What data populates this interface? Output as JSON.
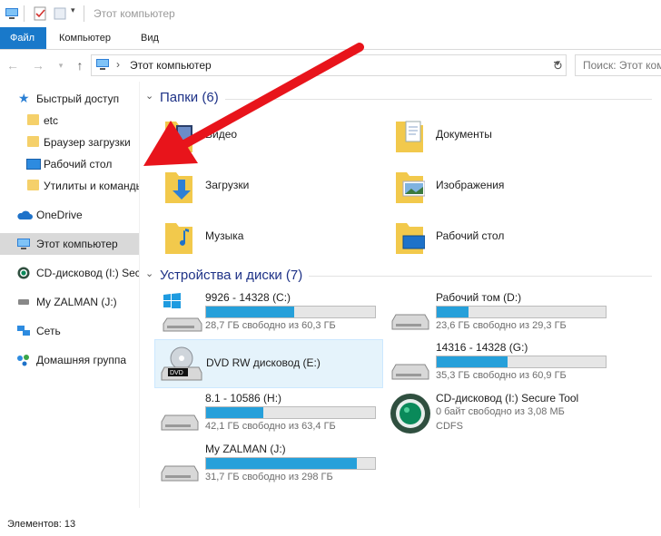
{
  "window": {
    "title": "Этот компьютер"
  },
  "ribbon": {
    "tabs": [
      {
        "label": "Файл",
        "active": true
      },
      {
        "label": "Компьютер",
        "active": false
      },
      {
        "label": "Вид",
        "active": false
      }
    ]
  },
  "address": {
    "path": "Этот компьютер",
    "separator": "›",
    "search_placeholder": "Поиск: Этот ком"
  },
  "nav": {
    "items": [
      {
        "label": "Быстрый доступ",
        "icon": "star-icon"
      },
      {
        "label": "etc",
        "icon": "folder-icon"
      },
      {
        "label": "Браузер загрузки",
        "icon": "folder-icon"
      },
      {
        "label": "Рабочий стол",
        "icon": "desktop-icon"
      },
      {
        "label": "Утилиты и команды",
        "icon": "folder-icon"
      },
      {
        "label": "OneDrive",
        "icon": "cloud-icon"
      },
      {
        "label": "Этот компьютер",
        "icon": "computer-icon",
        "selected": true
      },
      {
        "label": "CD-дисковод (I:) Secure Tool",
        "icon": "cd-icon"
      },
      {
        "label": "My ZALMAN (J:)",
        "icon": "usb-drive-icon"
      },
      {
        "label": "Сеть",
        "icon": "network-icon"
      },
      {
        "label": "Домашняя группа",
        "icon": "homegroup-icon"
      }
    ]
  },
  "folders": {
    "header": "Папки (6)",
    "items": [
      {
        "label": "Видео",
        "icon": "video-folder-icon"
      },
      {
        "label": "Документы",
        "icon": "documents-folder-icon"
      },
      {
        "label": "Загрузки",
        "icon": "downloads-folder-icon"
      },
      {
        "label": "Изображения",
        "icon": "pictures-folder-icon"
      },
      {
        "label": "Музыка",
        "icon": "music-folder-icon"
      },
      {
        "label": "Рабочий стол",
        "icon": "desktop-folder-icon"
      }
    ]
  },
  "drives": {
    "header": "Устройства и диски (7)",
    "items": [
      {
        "name": "9926 - 14328 (C:)",
        "free": "28,7 ГБ свободно из 60,3 ГБ",
        "fill": 0.52,
        "icon": "windows-drive-icon"
      },
      {
        "name": "Рабочий том (D:)",
        "free": "23,6 ГБ свободно из 29,3 ГБ",
        "fill": 0.19,
        "icon": "hdd-icon"
      },
      {
        "name": "DVD RW дисковод (E:)",
        "free": "",
        "icon": "dvd-drive-icon",
        "selected": true
      },
      {
        "name": "14316 - 14328 (G:)",
        "free": "35,3 ГБ свободно из 60,9 ГБ",
        "fill": 0.42,
        "icon": "hdd-icon"
      },
      {
        "name": "8.1 - 10586 (H:)",
        "free": "42,1 ГБ свободно из 63,4 ГБ",
        "fill": 0.34,
        "icon": "hdd-icon"
      },
      {
        "name": "CD-дисковод (I:) Secure Tool",
        "free": "0 байт свободно из 3,08 МБ",
        "fs": "CDFS",
        "icon": "cd-secure-icon"
      },
      {
        "name": "My ZALMAN (J:)",
        "free": "31,7 ГБ свободно из 298 ГБ",
        "fill": 0.89,
        "icon": "hdd-icon"
      }
    ]
  },
  "status": {
    "items_count": "Элементов: 13"
  },
  "colors": {
    "accent": "#1979ca",
    "bar_fill": "#26a0da",
    "arrow": "#e8141b",
    "header": "#1e3287"
  }
}
